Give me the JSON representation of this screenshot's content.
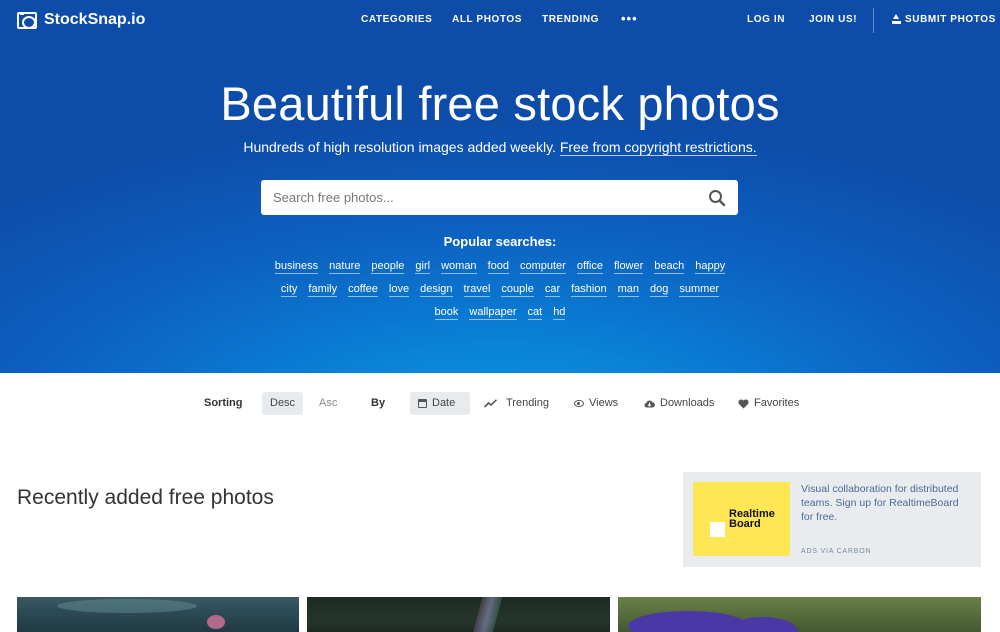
{
  "header": {
    "logo_text": "StockSnap.io",
    "nav": {
      "categories": "CATEGORIES",
      "all_photos": "ALL PHOTOS",
      "trending": "TRENDING",
      "more": "•••",
      "login": "LOG IN",
      "join": "JOIN US!",
      "submit": "SUBMIT PHOTOS"
    }
  },
  "hero": {
    "title": "Beautiful free stock photos",
    "subtitle_text": "Hundreds of high resolution images added weekly.",
    "subtitle_link": "Free from copyright restrictions.",
    "search": {
      "placeholder": "Search free photos...",
      "value": ""
    },
    "popular_title": "Popular searches:",
    "tags_row1": [
      "business",
      "nature",
      "people",
      "girl",
      "woman",
      "food",
      "computer",
      "office",
      "flower",
      "beach",
      "happy"
    ],
    "tags_row2": [
      "city",
      "family",
      "coffee",
      "love",
      "design",
      "travel",
      "couple",
      "car",
      "fashion",
      "man",
      "dog",
      "summer"
    ],
    "tags_row3": [
      "book",
      "wallpaper",
      "cat",
      "hd"
    ]
  },
  "sort_bar": {
    "sorting_label": "Sorting",
    "desc": "Desc",
    "asc": "Asc",
    "by_label": "By",
    "date": "Date",
    "trending": "Trending",
    "views": "Views",
    "downloads": "Downloads",
    "favorites": "Favorites",
    "active_order": "Desc",
    "active_by": "Date"
  },
  "recent": {
    "title": "Recently added free photos"
  },
  "ad": {
    "brand_line1": "Realtime",
    "brand_line2": "Board",
    "text": "Visual collaboration for distributed teams. Sign up for RealtimeBoard for free.",
    "via": "ADS VIA CARBON",
    "brand_color": "#ffe654",
    "background": "#e9ecef"
  },
  "colors": {
    "hero_dark": "#0d4ca8",
    "hero_light": "#0a9ce0",
    "text_on_hero": "#ffffff"
  }
}
